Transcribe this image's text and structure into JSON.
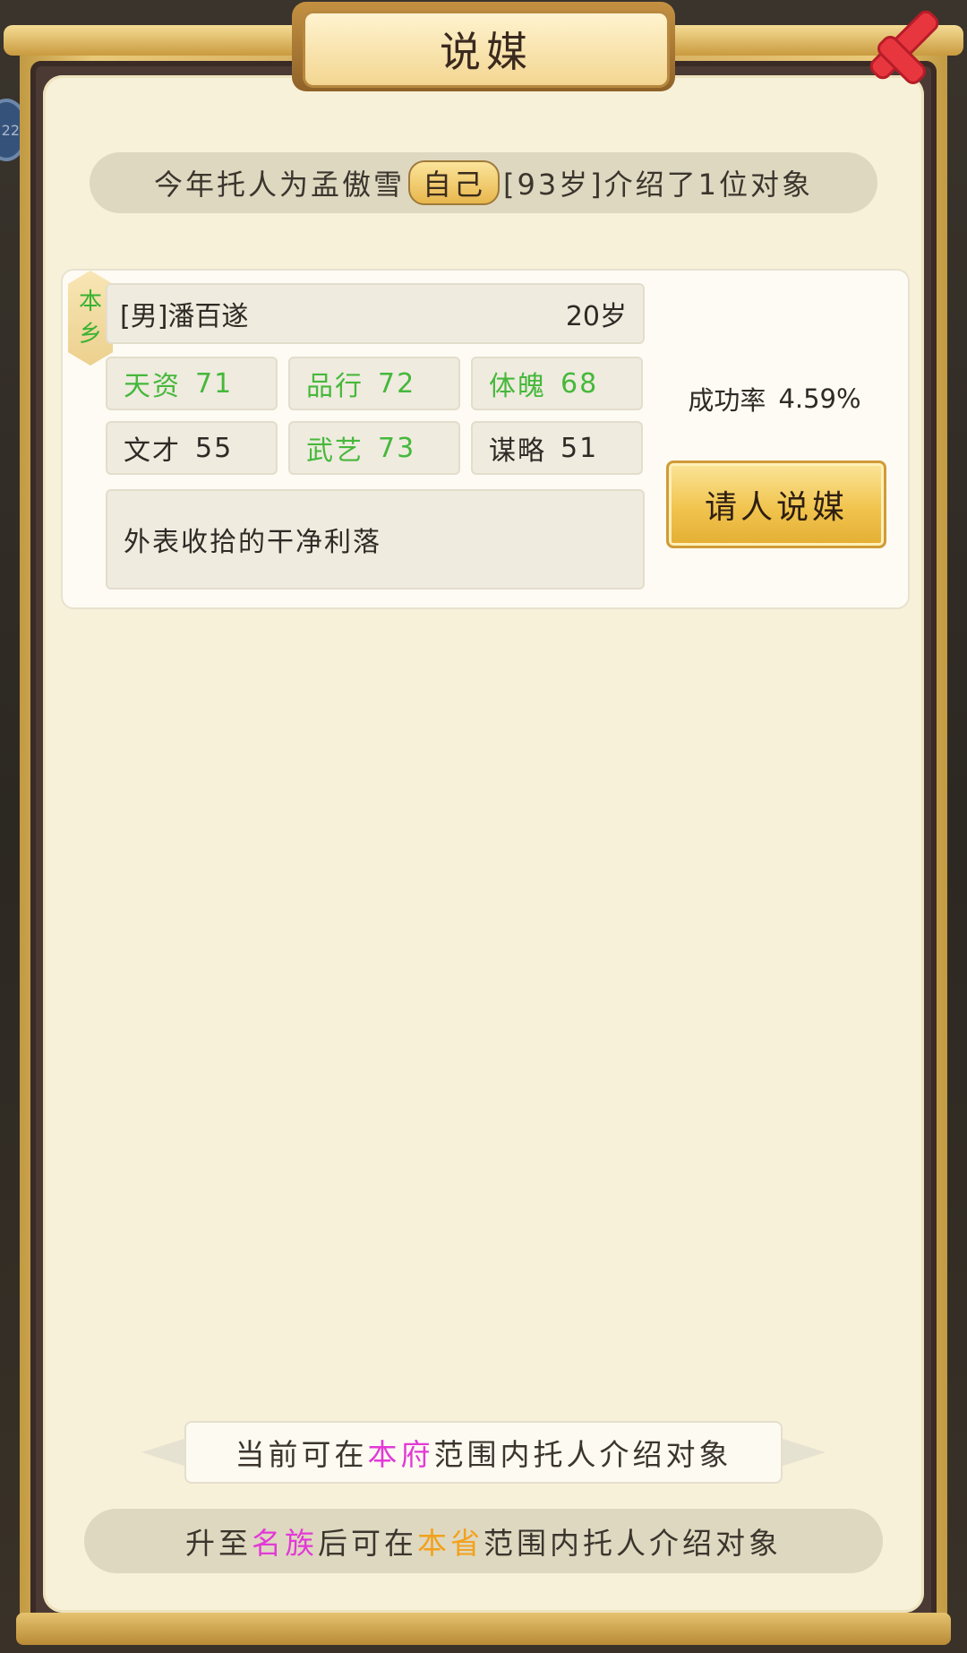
{
  "dialog": {
    "title": "说媒",
    "close_icon": "close-x-icon",
    "side_badge_text": "22"
  },
  "intro": {
    "prefix": "今年托人为孟傲雪",
    "self_tag": "自己",
    "age_text": "[93岁]",
    "suffix": "介绍了1位对象"
  },
  "candidate": {
    "origin_tag_line1": "本",
    "origin_tag_line2": "乡",
    "name": "[男]潘百遂",
    "age": "20岁",
    "stats": [
      {
        "label": "天资",
        "value": "71"
      },
      {
        "label": "品行",
        "value": "72"
      },
      {
        "label": "体魄",
        "value": "68"
      },
      {
        "label": "文才",
        "value": "55"
      },
      {
        "label": "武艺",
        "value": "73"
      },
      {
        "label": "谋略",
        "value": "51"
      }
    ],
    "description": "外表收拾的干净利落",
    "success_rate_label": "成功率",
    "success_rate_value": "4.59%",
    "match_button": "请人说媒"
  },
  "scope": {
    "current_prefix": "当前可在",
    "current_highlight": "本府",
    "current_suffix": "范围内托人介绍对象",
    "upgrade_prefix": "升至",
    "upgrade_highlight1": "名族",
    "upgrade_mid": "后可在",
    "upgrade_highlight2": "本省",
    "upgrade_suffix": "范围内托人介绍对象"
  },
  "colors": {
    "paper": "#f8f1d9",
    "gold": "#e9c979",
    "stat_green": "#46b83b",
    "highlight_magenta": "#e23ad6",
    "highlight_orange": "#f3a11c",
    "close_red": "#e8363f"
  }
}
